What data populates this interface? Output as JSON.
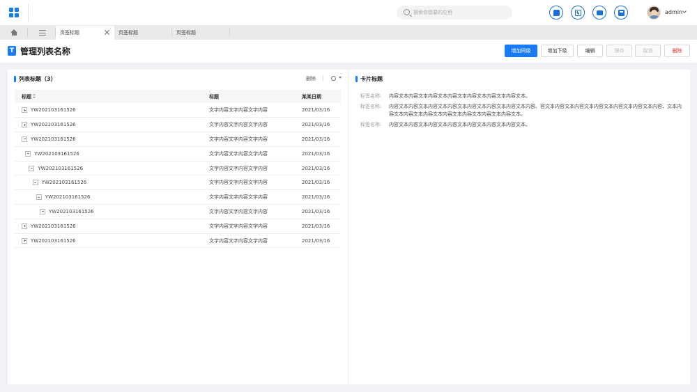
{
  "header": {
    "search_placeholder": "搜索你想要的应用",
    "user": {
      "name": "admin"
    },
    "icons": [
      "message-icon",
      "calendar-icon",
      "mail-icon",
      "monitor-icon"
    ]
  },
  "tabs": [
    {
      "label": "页签标题",
      "active": true,
      "closable": true
    },
    {
      "label": "页签标题",
      "active": false
    },
    {
      "label": "页签标题",
      "active": false
    }
  ],
  "page": {
    "title_badge": "T",
    "title": "管理列表名称",
    "buttons": {
      "add_sibling": "增加同级",
      "add_child": "增加下级",
      "edit": "编辑",
      "save": "保存",
      "cancel": "取消",
      "delete": "删除"
    }
  },
  "list": {
    "title": "列表标题（3）",
    "delete": "删除",
    "columns": [
      "标题",
      "标题",
      "某某日期"
    ],
    "rows": [
      {
        "code": "YW202103161526",
        "text": "文字内容文字内容文字内容",
        "date": "2021/03/16",
        "level": 0,
        "toggle": "+"
      },
      {
        "code": "YW202103161526",
        "text": "文字内容文字内容文字内容",
        "date": "2021/03/16",
        "level": 0,
        "toggle": "+"
      },
      {
        "code": "YW202103161526",
        "text": "文字内容文字内容文字内容",
        "date": "2021/03/16",
        "level": 0,
        "toggle": "-"
      },
      {
        "code": "YW202103161526",
        "text": "文字内容文字内容文字内容",
        "date": "2021/03/16",
        "level": 1,
        "toggle": "-"
      },
      {
        "code": "YW202103161526",
        "text": "文字内容文字内容文字内容",
        "date": "2021/03/16",
        "level": 2,
        "toggle": "-"
      },
      {
        "code": "YW202103161526",
        "text": "文字内容文字内容文字内容",
        "date": "2021/03/16",
        "level": 3,
        "toggle": "-"
      },
      {
        "code": "YW202103161526",
        "text": "文字内容文字内容文字内容",
        "date": "2021/03/16",
        "level": 4,
        "toggle": "-"
      },
      {
        "code": "YW202103161526",
        "text": "文字内容文字内容文字内容",
        "date": "2021/03/16",
        "level": 5,
        "toggle": "-"
      },
      {
        "code": "YW202103161526",
        "text": "文字内容文字内容文字内容",
        "date": "2021/03/16",
        "level": 0,
        "toggle": "+"
      },
      {
        "code": "YW202103161526",
        "text": "文字内容文字内容文字内容",
        "date": "2021/03/16",
        "level": 0,
        "toggle": "+"
      }
    ]
  },
  "card": {
    "title": "卡片标题",
    "fields": [
      {
        "label": "标签名称:",
        "value": "内容文本内容文本内容文本内容文本内容文本内容文本内容文本。"
      },
      {
        "label": "标签名称:",
        "value": "内容文本内容文本内容文本内容文本内容文本内容文本内容文本内容、容文本内容文本内容文本内容文本内容文本内容文本内容、文本内容文本内容文本内容文本内容文本内容文本内容文本内容文本。"
      },
      {
        "label": "标签名称:",
        "value": "内容文本内容文本内容文本内容文本内容文本内容文本内容文本。"
      }
    ]
  },
  "colors": {
    "primary": "#1a7cf5",
    "danger": "#e8342e"
  }
}
